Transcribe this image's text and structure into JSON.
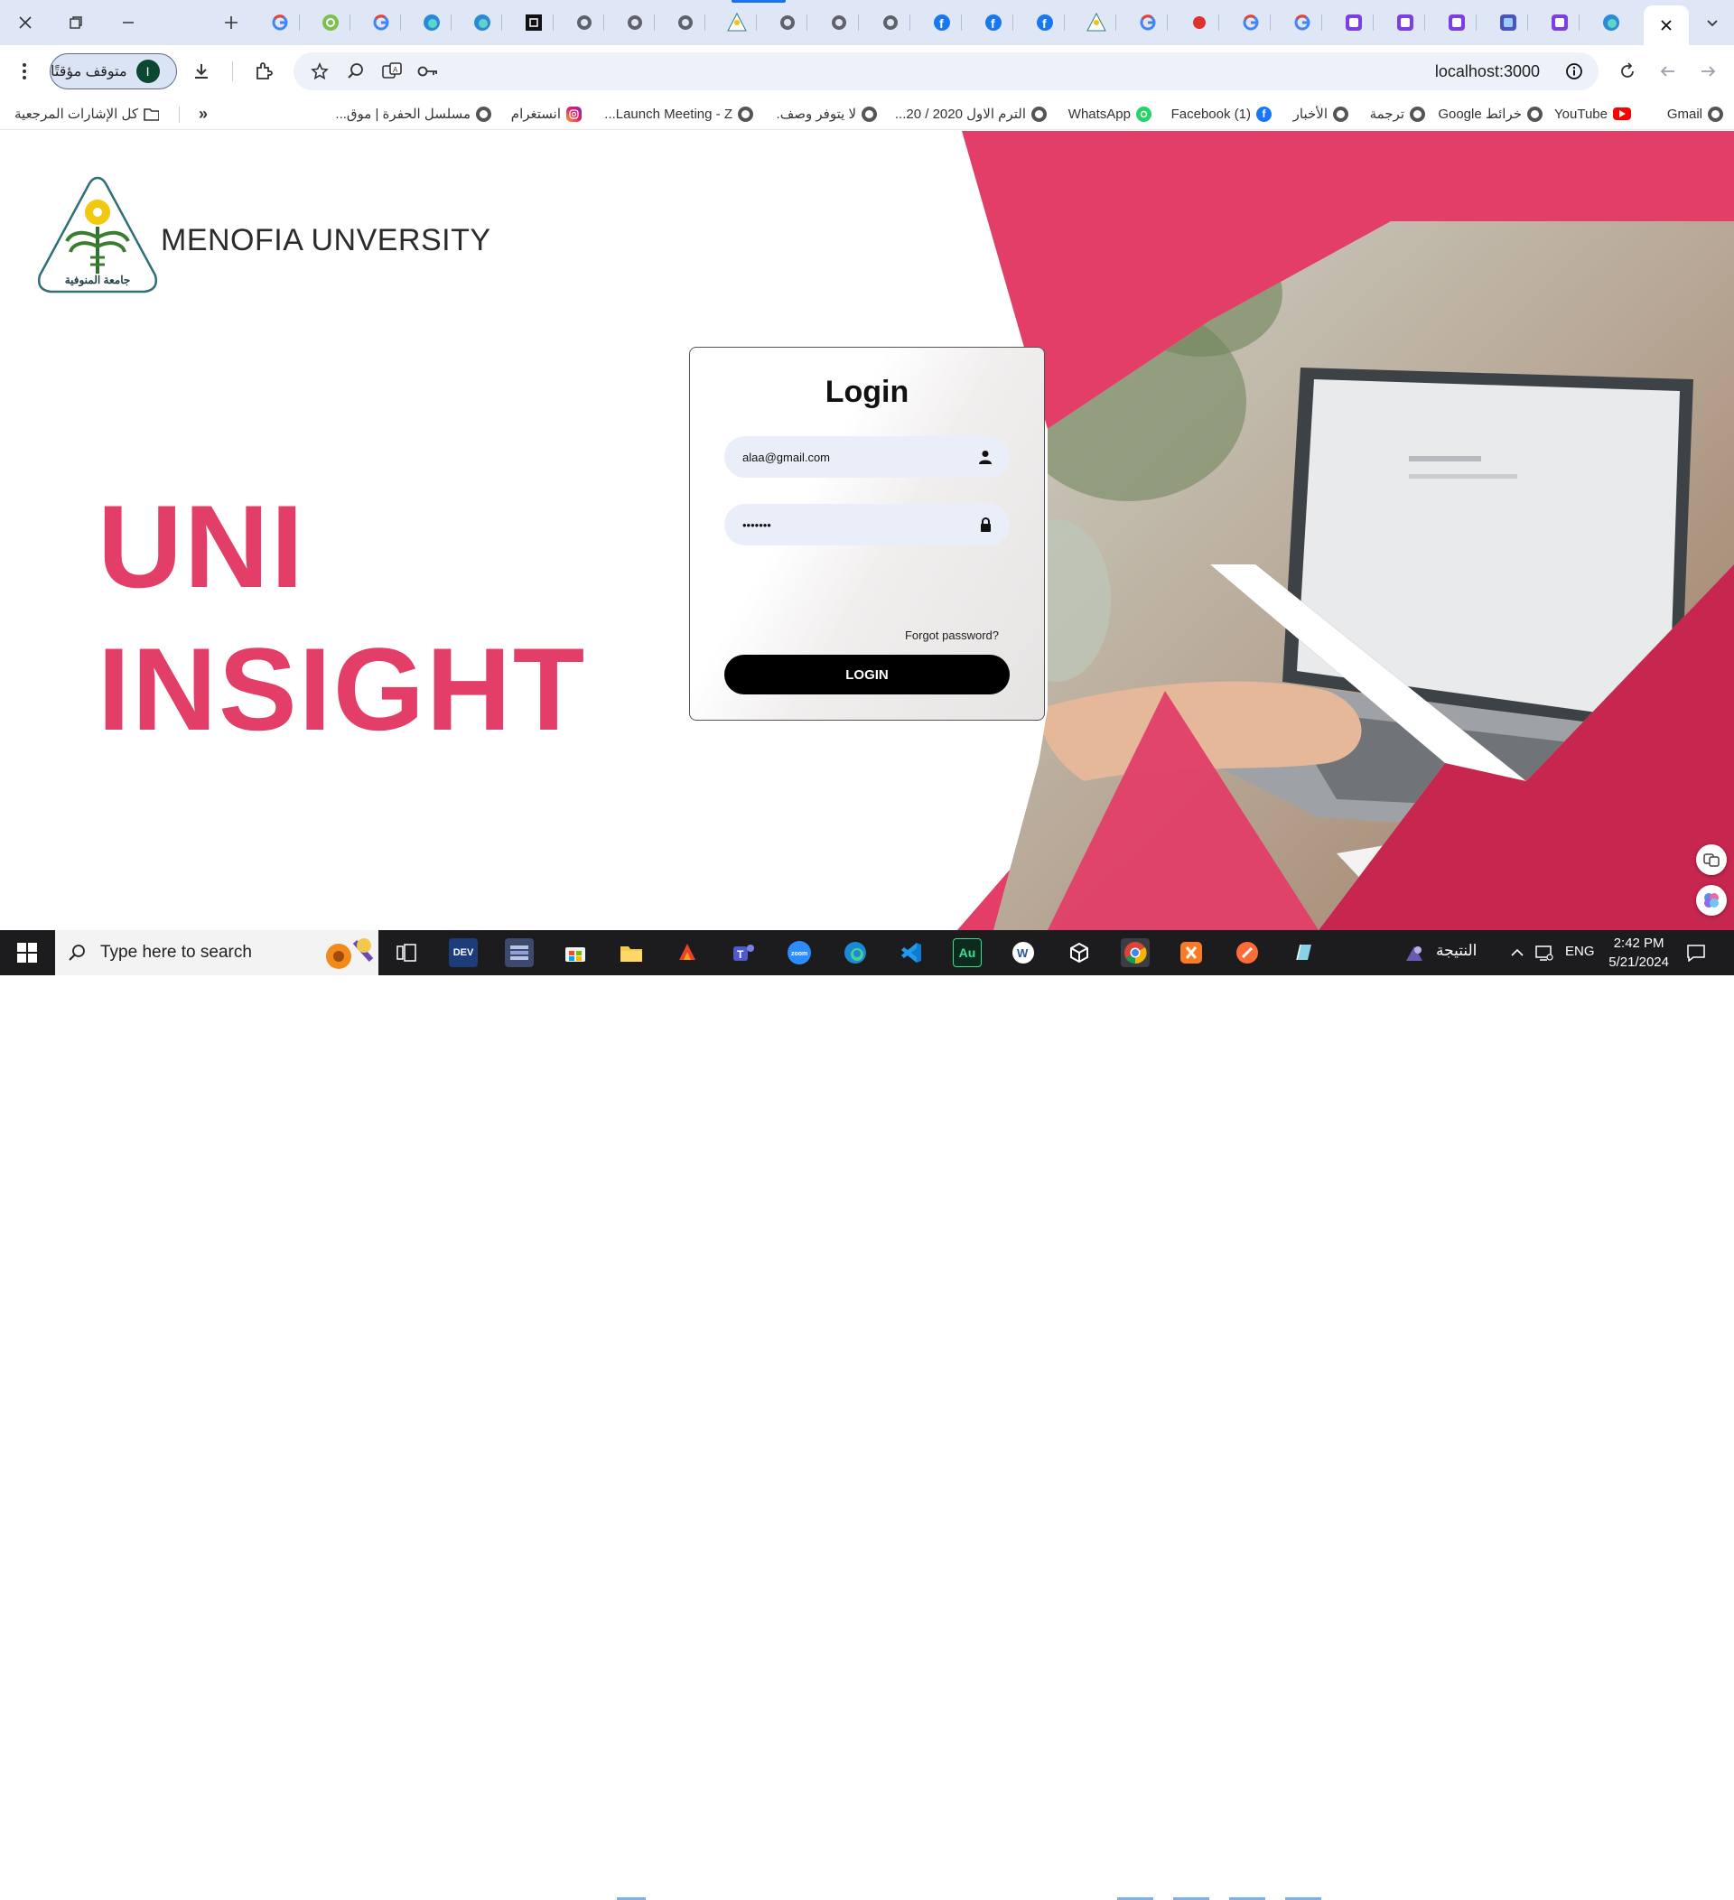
{
  "browser": {
    "url": "localhost:3000",
    "profile": {
      "status": "متوقف مؤقتًا",
      "initial": "I"
    },
    "tabs": [
      {
        "icon": "google-icon"
      },
      {
        "icon": "green-chat-icon"
      },
      {
        "icon": "google-icon"
      },
      {
        "icon": "edge-copilot-icon"
      },
      {
        "icon": "edge-copilot-icon"
      },
      {
        "icon": "black-square-icon"
      },
      {
        "icon": "globe-icon"
      },
      {
        "icon": "globe-icon"
      },
      {
        "icon": "globe-icon"
      },
      {
        "icon": "university-logo-icon"
      },
      {
        "icon": "globe-icon"
      },
      {
        "icon": "globe-icon"
      },
      {
        "icon": "globe-icon"
      },
      {
        "icon": "facebook-icon"
      },
      {
        "icon": "facebook-icon"
      },
      {
        "icon": "facebook-icon"
      },
      {
        "icon": "university-logo-icon"
      },
      {
        "icon": "google-icon"
      },
      {
        "icon": "red-dot-icon"
      },
      {
        "icon": "google-icon"
      },
      {
        "icon": "google-icon"
      },
      {
        "icon": "teams-icon"
      },
      {
        "icon": "teams-icon"
      },
      {
        "icon": "teams-icon"
      },
      {
        "icon": "teams-blue-icon"
      },
      {
        "icon": "teams-icon"
      },
      {
        "icon": "edge-copilot-icon"
      }
    ],
    "bookmarks": {
      "all_bookmarks": "كل الإشارات المرجعية",
      "items": [
        {
          "label": "Gmail",
          "icon": "globe-icon"
        },
        {
          "label": "YouTube",
          "icon": "youtube-icon"
        },
        {
          "label": "خرائط Google",
          "icon": "globe-icon"
        },
        {
          "label": "ترجمة",
          "icon": "globe-icon"
        },
        {
          "label": "الأخبار",
          "icon": "globe-icon"
        },
        {
          "label": "(1) Facebook",
          "icon": "facebook-icon"
        },
        {
          "label": "WhatsApp",
          "icon": "whatsapp-icon"
        },
        {
          "label": "الترم الاول 2020 / 20...",
          "icon": "globe-icon"
        },
        {
          "label": "لا يتوفر وصف.",
          "icon": "globe-icon"
        },
        {
          "label": "Launch Meeting - Z...",
          "icon": "globe-icon"
        },
        {
          "label": "انستغرام",
          "icon": "instagram-icon"
        },
        {
          "label": "مسلسل الحفرة | موق...",
          "icon": "globe-icon"
        }
      ]
    }
  },
  "page": {
    "university_name": "MENOFIA UNVERSITY",
    "logo_caption": "جامعة المنوفية",
    "hero_line1": "UNI",
    "hero_line2": "INSIGHT",
    "accent_color": "#e23e68",
    "login": {
      "title": "Login",
      "email_value": "alaa@gmail.com",
      "password_value": "•••••••",
      "forgot_label": "Forgot password?",
      "button_label": "LOGIN"
    }
  },
  "taskbar": {
    "search_placeholder": "Type here to search",
    "weather_label": "النتيجة",
    "language": "ENG",
    "time": "2:42 PM",
    "date": "5/21/2024",
    "apps": [
      "task-view-icon",
      "devc-icon",
      "app-grid-icon",
      "microsoft-store-icon",
      "file-explorer-icon",
      "office-icon",
      "teams-icon",
      "zoom-icon",
      "edge-icon",
      "vscode-icon",
      "audition-icon",
      "word-icon",
      "unity-icon",
      "chrome-icon",
      "xampp-icon",
      "postman-icon",
      "notepad-icon"
    ]
  }
}
